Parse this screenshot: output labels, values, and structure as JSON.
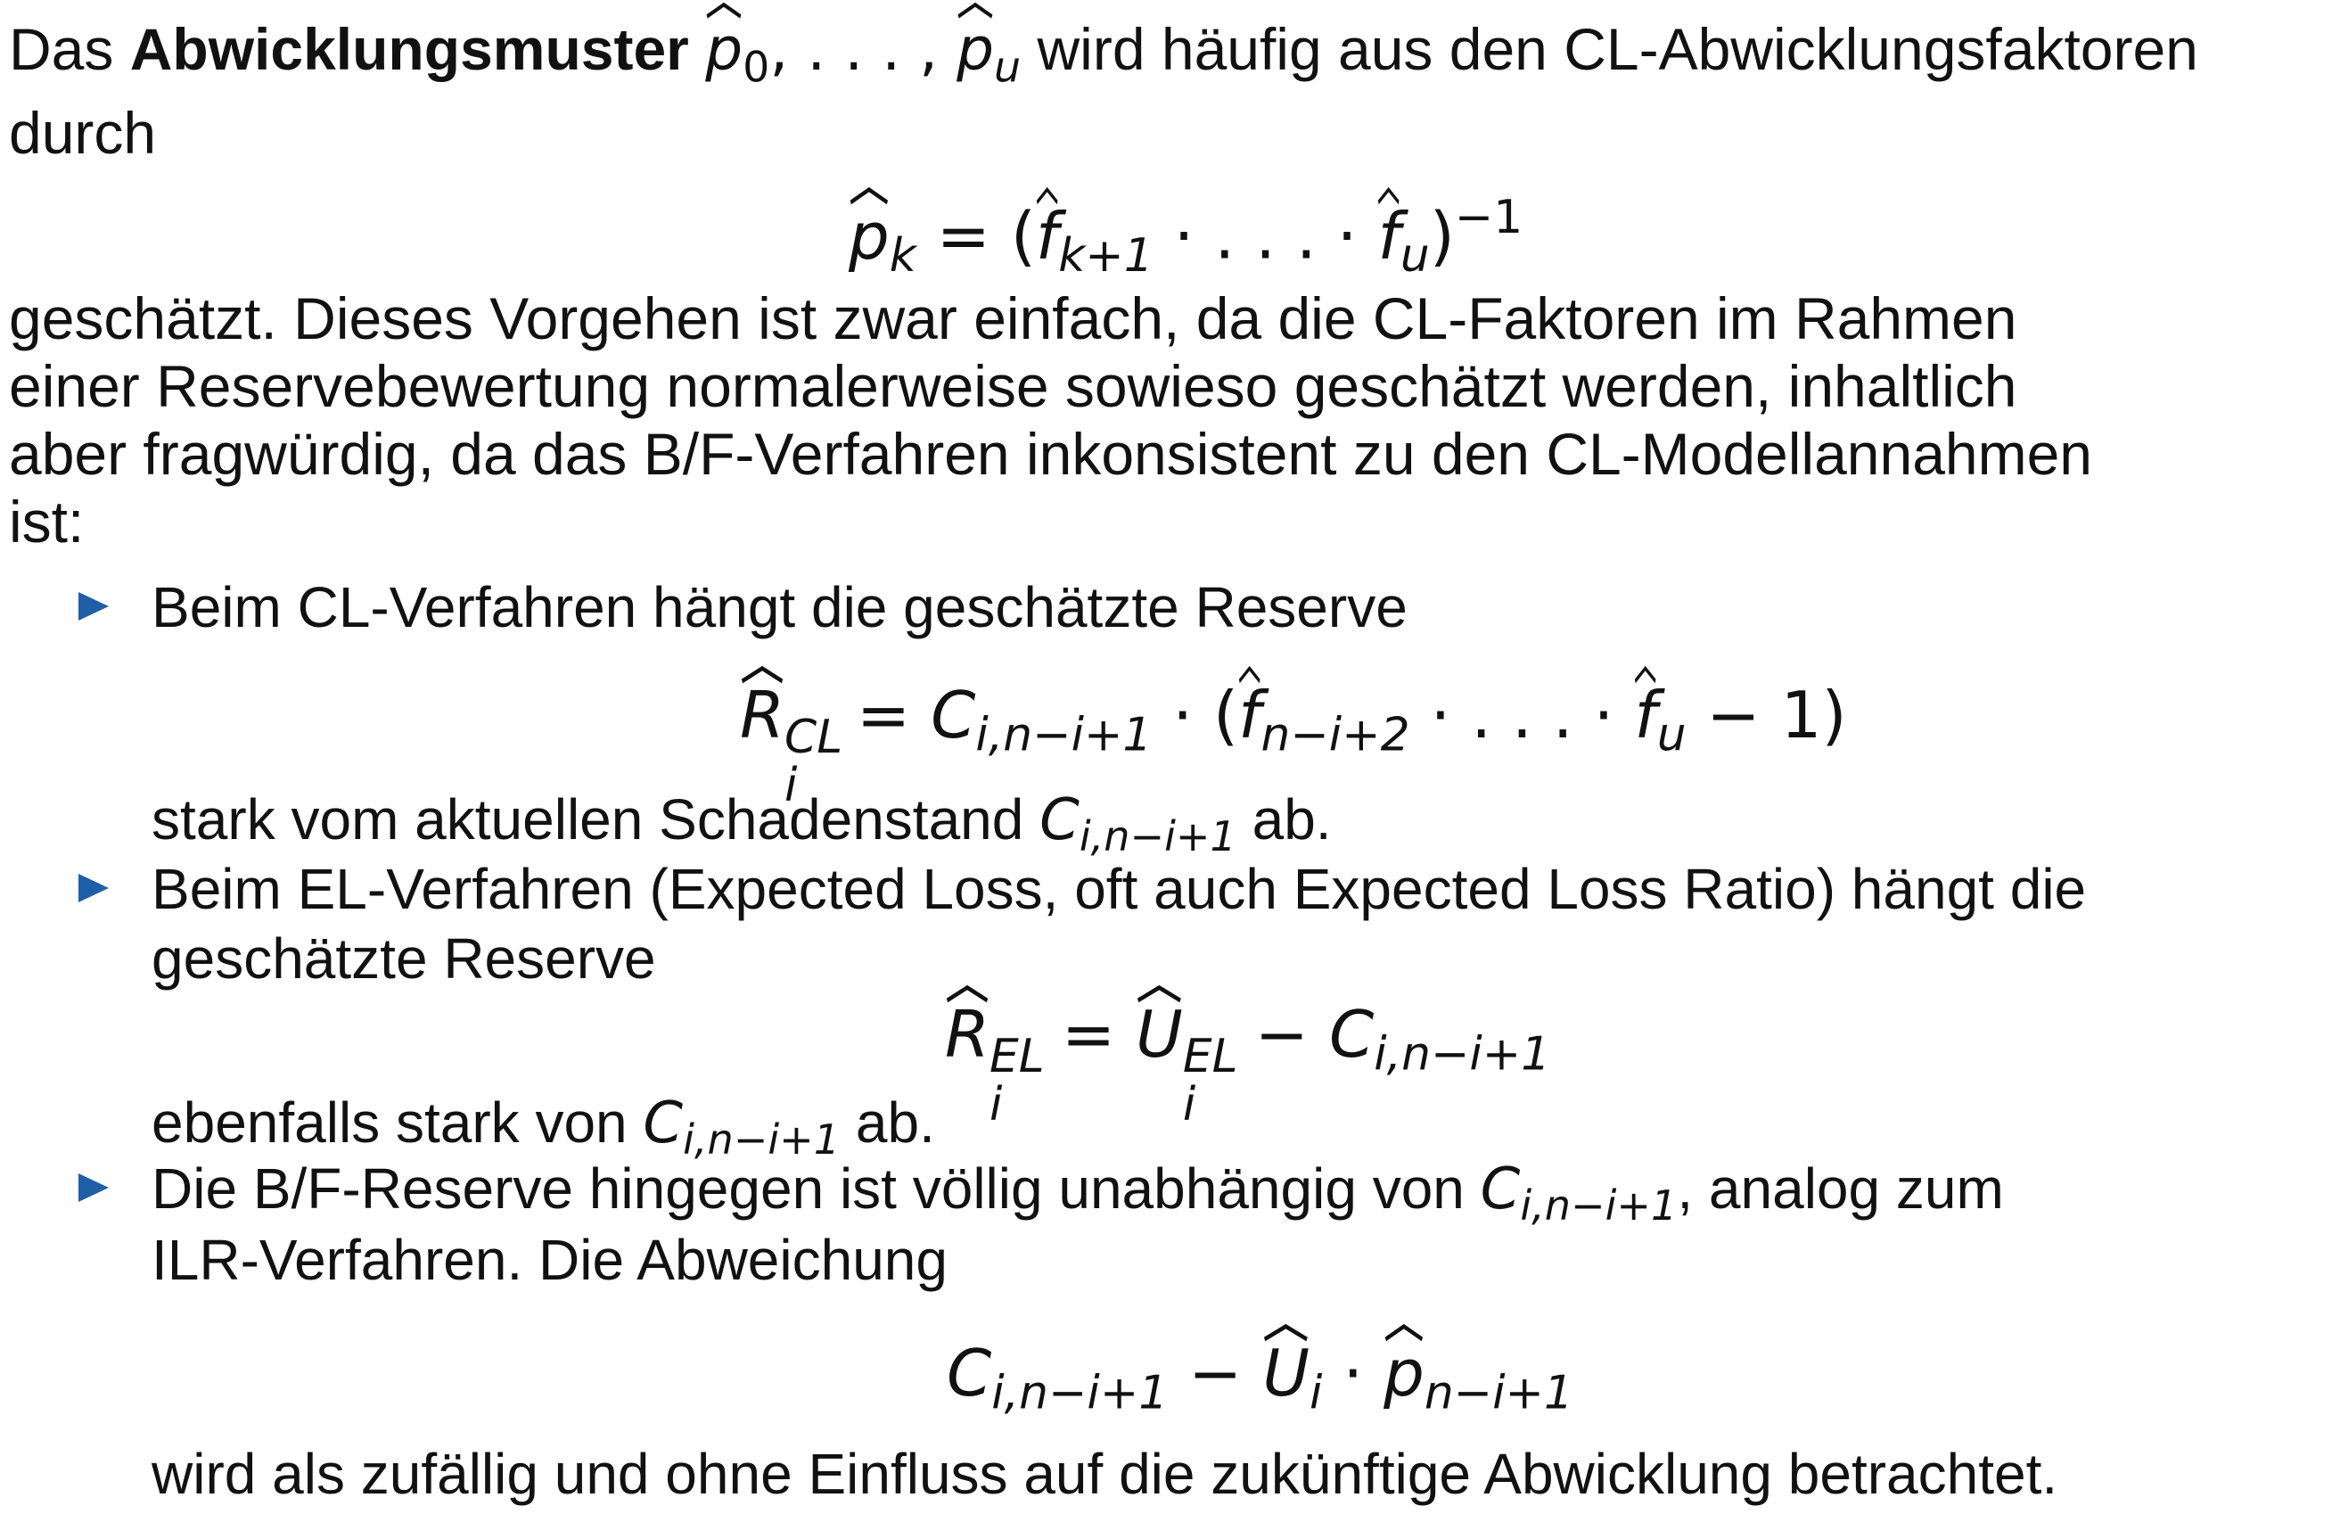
{
  "intro": {
    "text_before_bold": "Das ",
    "bold_term": "Abwicklungsmuster",
    "text_after_math": " wird häufig aus den CL-Abwicklungsfaktoren",
    "line2": "durch",
    "pattern_math": {
      "p": "p",
      "sub0": "0",
      "ellipsis": ", . . . , ",
      "subu": "u"
    }
  },
  "formula1": {
    "lhs_p": "p",
    "lhs_sub": "k",
    "equals": "=",
    "open": "(",
    "f1": "f",
    "f1_sub": "k+1",
    "dots": " · . . . · ",
    "f2": "f",
    "f2_sub": "u",
    "close": ")",
    "exp": "−1"
  },
  "paragraph2": {
    "line1": "geschätzt. Dieses Vorgehen ist zwar einfach, da die CL-Faktoren im Rahmen",
    "line2": "einer Reservebewertung normalerweise sowieso geschätzt werden, inhaltlich",
    "line3": "aber fragwürdig, da das B/F-Verfahren inkonsistent zu den CL-Modellannahmen",
    "line4": "ist:"
  },
  "bullets": [
    {
      "line1": "Beim CL-Verfahren hängt die geschätzte Reserve",
      "formula": {
        "R": "R",
        "R_sub": "i",
        "R_sup": "CL",
        "equals": "=",
        "C": "C",
        "C_sub": "i,n−i+1",
        "dot": " · (",
        "f1": "f",
        "f1_sub": "n−i+2",
        "dots": " · . . . · ",
        "f2": "f",
        "f2_sub": "u",
        "tail": " − 1)"
      },
      "after_before": "stark vom aktuellen Schadenstand ",
      "after_C": "C",
      "after_C_sub": "i,n−i+1",
      "after_end": " ab."
    },
    {
      "line1": "Beim EL-Verfahren (Expected Loss, oft auch Expected Loss Ratio) hängt die",
      "line2": "geschätzte Reserve",
      "formula": {
        "R": "R",
        "R_sub": "i",
        "R_sup": "EL",
        "equals": "=",
        "U": "U",
        "U_sub": "i",
        "U_sup": "EL",
        "minus": "−",
        "C": "C",
        "C_sub": "i,n−i+1"
      },
      "after_before": "ebenfalls stark von ",
      "after_C": "C",
      "after_C_sub": "i,n−i+1",
      "after_end": " ab."
    },
    {
      "line1_before": "Die B/F-Reserve hingegen ist völlig unabhängig von ",
      "line1_C": "C",
      "line1_C_sub": "i,n−i+1",
      "line1_after": ", analog zum",
      "line2": "ILR-Verfahren. Die Abweichung",
      "formula": {
        "C": "C",
        "C_sub": "i,n−i+1",
        "minus": "−",
        "U": "U",
        "U_sub": "i",
        "dot": "·",
        "p": "p",
        "p_sub": "n−i+1"
      },
      "after": "wird als zufällig und ohne Einfluss auf die zukünftige Abwicklung betrachtet."
    }
  ],
  "colors": {
    "bullet": "#1f5fa8",
    "text": "#111111"
  }
}
